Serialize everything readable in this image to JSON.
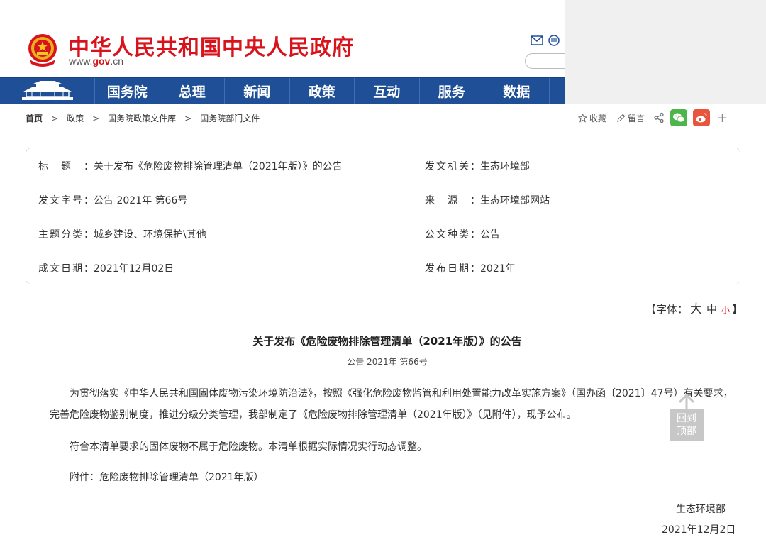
{
  "header": {
    "site_title": "中华人民共和国中央人民政府",
    "site_url_pre": "www.",
    "site_url_brand": "gov",
    "site_url_post": ".cn"
  },
  "nav": {
    "items": [
      "国务院",
      "总理",
      "新闻",
      "政策",
      "互动",
      "服务",
      "数据"
    ]
  },
  "breadcrumb": [
    "首页",
    "政策",
    "国务院政策文件库",
    "国务院部门文件"
  ],
  "tools": {
    "favorite": "收藏",
    "comment": "留言",
    "more": "+"
  },
  "info": {
    "rows": [
      {
        "l_label": "标题：",
        "l_value": "关于发布《危险废物排除管理清单（2021年版）》的公告",
        "r_label": "发文机关：",
        "r_value": "生态环境部"
      },
      {
        "l_label": "发文字号：",
        "l_value": "公告 2021年 第66号",
        "r_label": "来源：",
        "r_value": "生态环境部网站"
      },
      {
        "l_label": "主题分类：",
        "l_value": "城乡建设、环境保护\\其他",
        "r_label": "公文种类：",
        "r_value": "公告"
      },
      {
        "l_label": "成文日期：",
        "l_value": "2021年12月02日",
        "r_label": "发布日期：",
        "r_value": "2021年"
      }
    ]
  },
  "font_switch": {
    "open": "【字体：",
    "big": "大",
    "mid": "中",
    "small": "小",
    "close": "】"
  },
  "article": {
    "title": "关于发布《危险废物排除管理清单（2021年版）》的公告",
    "doc_no": "公告 2021年 第66号",
    "p1_line1": "为贯彻落实《中华人民共和国固体废物污染环境防治法》，按照《强化危险废物监管和利用处置能力改革实施方案》（国办函〔2021〕47号）有关要求，",
    "p1_line2": "完善危险废物鉴别制度，推进分级分类管理，我部制定了《危险废物排除管理清单（2021年版）》（见附件），现予公布。",
    "p2": "符合本清单要求的固体废物不属于危险废物。本清单根据实际情况实行动态调整。",
    "p3": "附件：危险废物排除管理清单（2021年版）",
    "sign_org": "生态环境部",
    "sign_date": "2021年12月2日"
  },
  "back_top": {
    "line1": "回到",
    "line2": "顶部"
  },
  "colors": {
    "brand_red": "#d9131b",
    "nav_blue": "#1e4f97",
    "wechat_green": "#4cb64a",
    "weibo_orange": "#e8543e"
  }
}
